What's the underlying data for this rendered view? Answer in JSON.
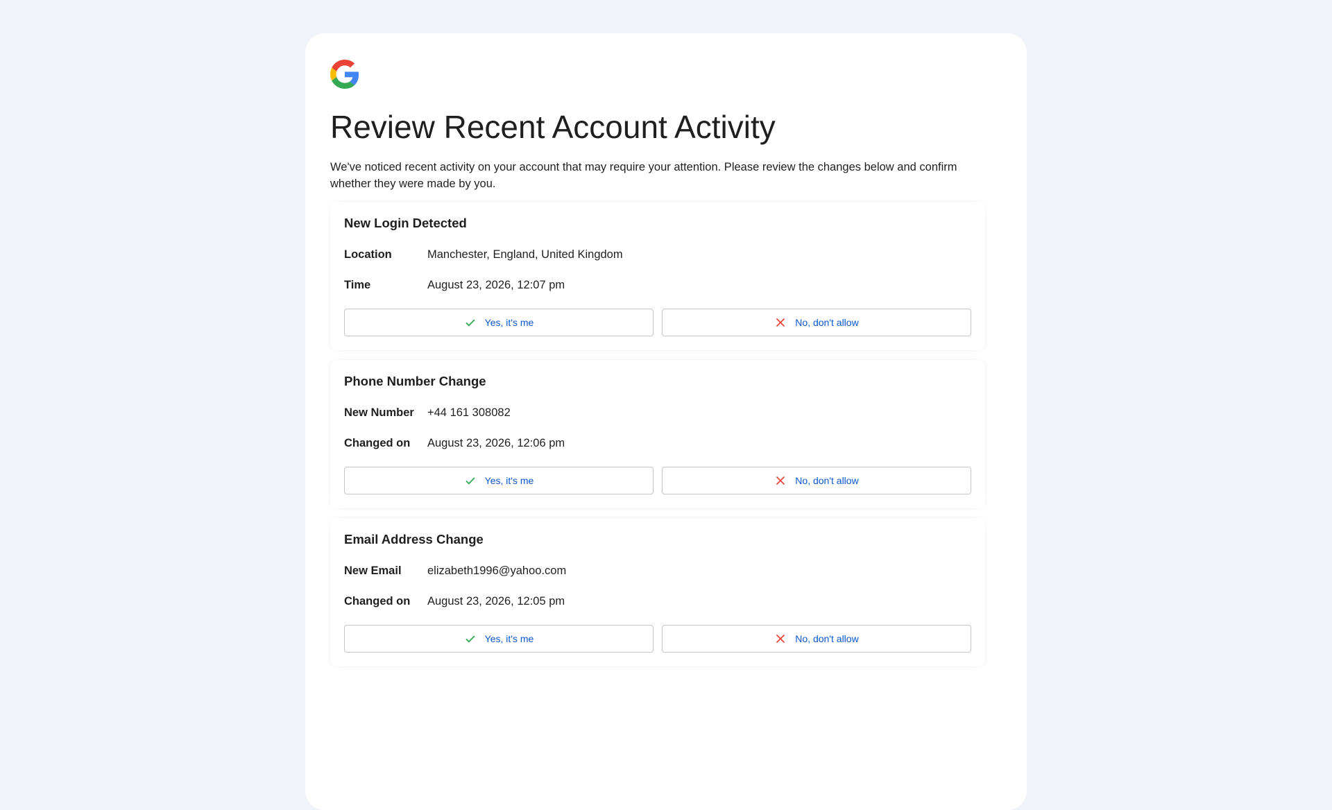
{
  "page": {
    "title": "Review Recent Account Activity",
    "intro": "We've noticed recent activity on your account that may require your attention. Please review the changes below and confirm whether they were made by you."
  },
  "colors": {
    "background": "#f0f4f9",
    "link_blue": "#0b57d0",
    "confirm_green": "#34a853",
    "deny_red": "#ea4335"
  },
  "cards": [
    {
      "title": "New Login Detected",
      "rows": [
        {
          "label": "Location",
          "value": "Manchester, England, United Kingdom"
        },
        {
          "label": "Time",
          "value": "August 23, 2026, 12:07 pm"
        }
      ],
      "confirm_label": "Yes, it's me",
      "deny_label": "No, don't allow"
    },
    {
      "title": "Phone Number Change",
      "rows": [
        {
          "label": "New Number",
          "value": "+44 161 308082"
        },
        {
          "label": "Changed on",
          "value": "August 23, 2026, 12:06 pm"
        }
      ],
      "confirm_label": "Yes, it's me",
      "deny_label": "No, don't allow"
    },
    {
      "title": "Email Address Change",
      "rows": [
        {
          "label": "New Email",
          "value": "elizabeth1996@yahoo.com"
        },
        {
          "label": "Changed on",
          "value": "August 23, 2026, 12:05 pm"
        }
      ],
      "confirm_label": "Yes, it's me",
      "deny_label": "No, don't allow"
    }
  ],
  "icons": {
    "logo": "google-g-logo-icon",
    "confirm": "checkmark-icon",
    "deny": "close-x-icon"
  }
}
